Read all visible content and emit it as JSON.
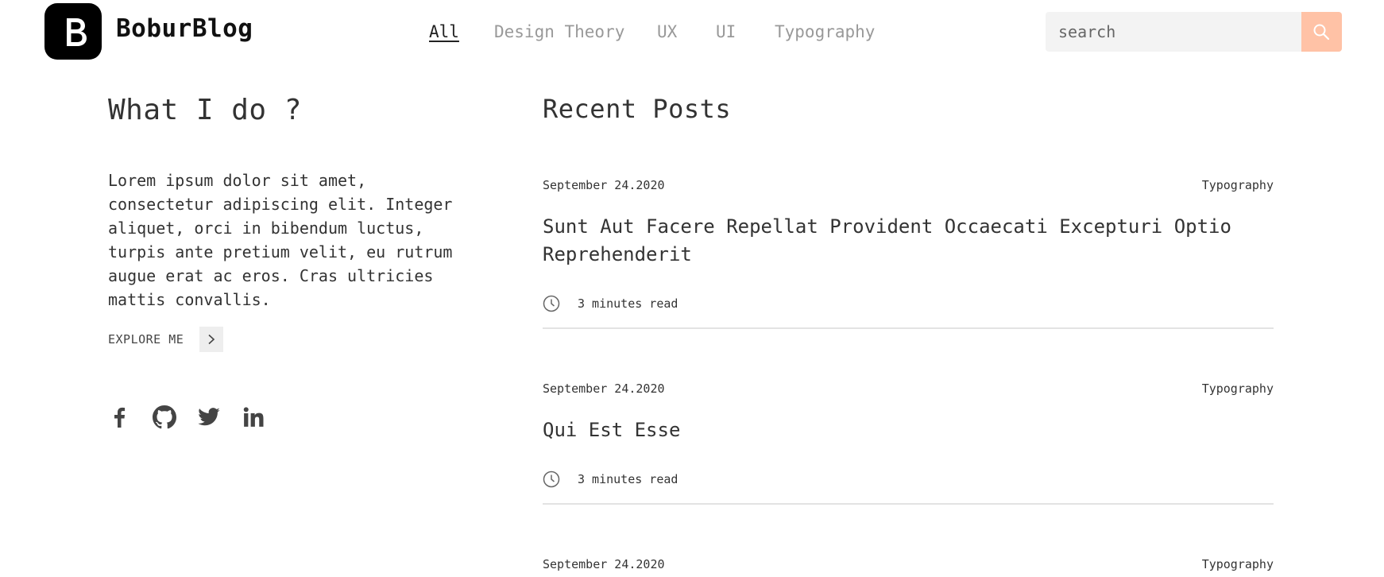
{
  "brand": {
    "name": "BoburBlog"
  },
  "nav": [
    {
      "label": "All",
      "active": true
    },
    {
      "label": "Design Theory",
      "active": false
    },
    {
      "label": "UX",
      "active": false
    },
    {
      "label": "UI",
      "active": false
    },
    {
      "label": "Typography",
      "active": false
    }
  ],
  "search": {
    "placeholder": "search",
    "icon": "search-icon",
    "button_color": "#ffc2a6"
  },
  "about": {
    "heading": "What I do ?",
    "text": "Lorem ipsum dolor sit amet, consectetur adipiscing elit. Integer aliquet, orci in bibendum luctus, turpis ante pretium velit, eu rutrum augue erat ac eros. Cras ultricies mattis convallis.",
    "explore_label": "EXPLORE ME",
    "socials": [
      "facebook-icon",
      "github-icon",
      "twitter-icon",
      "linkedin-icon"
    ]
  },
  "recent": {
    "heading": "Recent Posts",
    "posts": [
      {
        "date": "September 24.2020",
        "category": "Typography",
        "title": "Sunt Aut Facere Repellat Provident Occaecati Excepturi Optio Reprehenderit",
        "read_time": "3 minutes read"
      },
      {
        "date": "September 24.2020",
        "category": "Typography",
        "title": "Qui Est Esse",
        "read_time": "3 minutes read"
      },
      {
        "date": "September 24.2020",
        "category": "Typography"
      }
    ]
  }
}
